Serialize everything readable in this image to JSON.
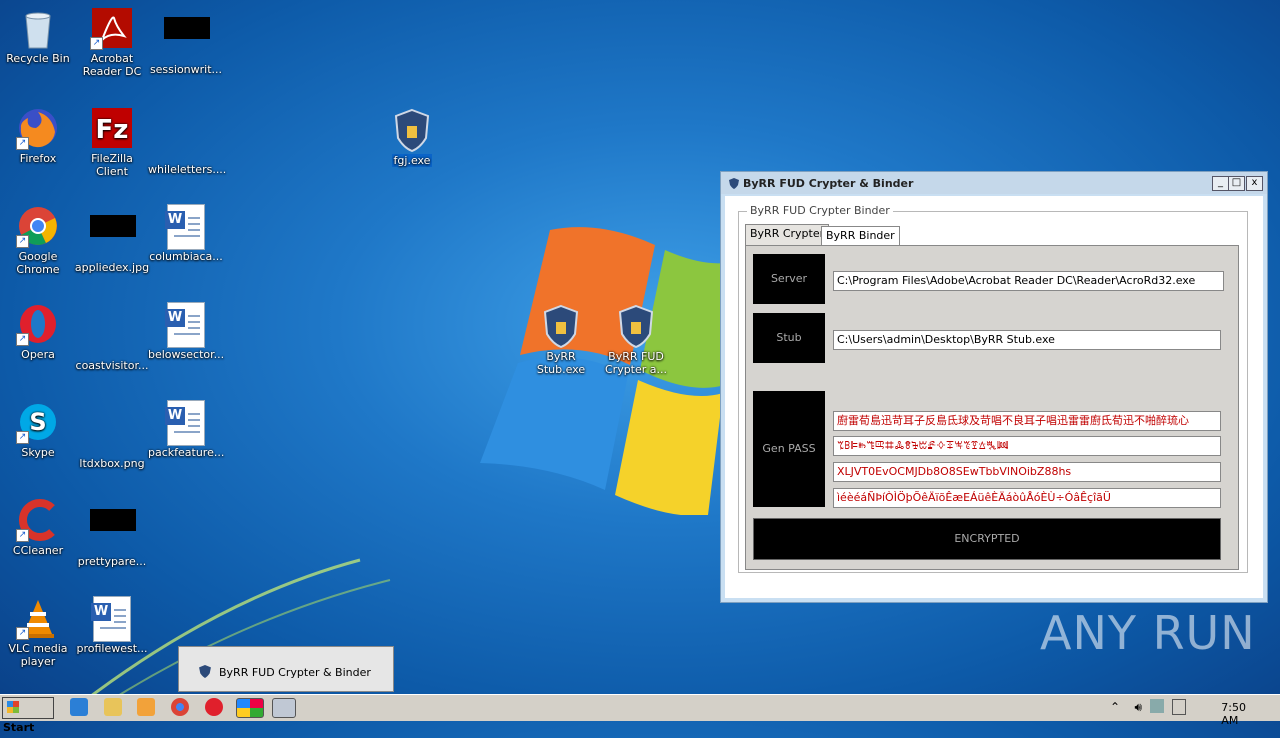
{
  "desktop": {
    "icons": [
      {
        "label": "Recycle Bin"
      },
      {
        "label": "Acrobat Reader DC"
      },
      {
        "label": "sessionwrit..."
      },
      {
        "label": "Firefox"
      },
      {
        "label": "FileZilla Client"
      },
      {
        "label": "whileletters...."
      },
      {
        "label": "Google Chrome"
      },
      {
        "label": "appliedex.jpg"
      },
      {
        "label": "columbiaca..."
      },
      {
        "label": "Opera"
      },
      {
        "label": "coastvisitor..."
      },
      {
        "label": "belowsector..."
      },
      {
        "label": "Skype"
      },
      {
        "label": "ltdxbox.png"
      },
      {
        "label": "packfeature..."
      },
      {
        "label": "CCleaner"
      },
      {
        "label": "prettypare..."
      },
      {
        "label": "VLC media player"
      },
      {
        "label": "profilewest..."
      },
      {
        "label": "fgj.exe"
      },
      {
        "label": "ByRR Stub.exe"
      },
      {
        "label": "ByRR FUD Crypter a..."
      }
    ],
    "watermark": "ANY RUN"
  },
  "window": {
    "title": "ByRR FUD Crypter & Binder",
    "group_title": "ByRR FUD Crypter  Binder",
    "tabs": [
      "ByRR Crypter",
      "ByRR Binder"
    ],
    "active_tab": "ByRR Crypter",
    "server_label": "Server",
    "server_value": "C:\\Program Files\\Adobe\\Acrobat Reader DC\\Reader\\AcroRd32.exe",
    "stub_label": "Stub",
    "stub_value": "C:\\Users\\admin\\Desktop\\ByRR Stub.exe",
    "genpass_label": "Gen PASS",
    "pass1": "廚雷荀島迅苛耳子反島氐球及苛唱不良耳子唱迅雷雷廚氐荀迅不啪醉琉心",
    "pass2": "ꔂꕗꕞꖳꔏꕓꖛꔆꗉꕳꔱꗖꕻꔊꖕꔳꗑꕖꔩꔞ",
    "pass3": "XLJVT0EvOCMJDb8O8SEwTbbVlNOibZ88hs",
    "pass4": "ìéèéáÑÞíÒÌÖþÕêÄïõÊæEÁüêÈÄáòûÅóÈÙ÷ÓâÊçîãÜ",
    "encrypted_label": "ENCRYPTED",
    "controls": {
      "minimize": "_",
      "maximize": "□",
      "close": "x"
    }
  },
  "taskbar": {
    "start_label": "Start",
    "preview_title": "ByRR FUD Crypter & Binder",
    "clock": "7:50 AM"
  }
}
